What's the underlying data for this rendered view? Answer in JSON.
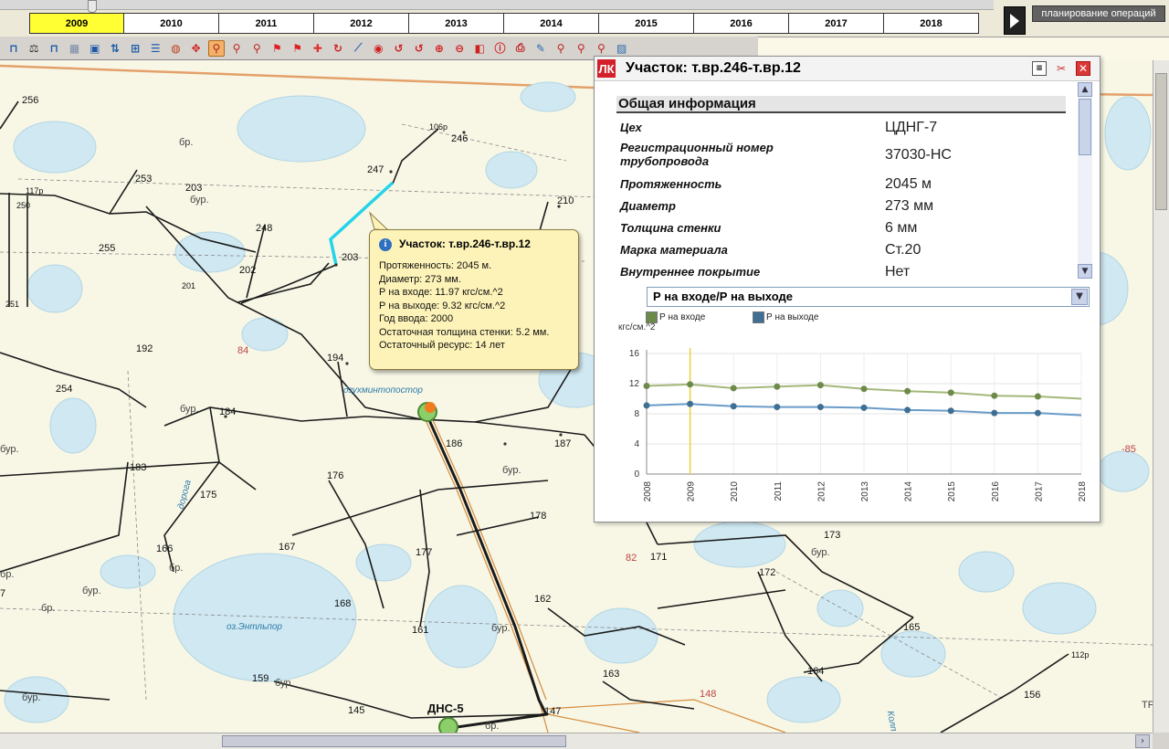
{
  "timeline": {
    "years": [
      "2009",
      "2010",
      "2011",
      "2012",
      "2013",
      "2014",
      "2015",
      "2016",
      "2017",
      "2018"
    ],
    "active_year": "2009",
    "ops_button": "планирование операций"
  },
  "toolbar": {
    "icons": [
      "pipe-shape-icon",
      "weight-icon",
      "pipe-shape-icon",
      "hatch-icon",
      "window-layout-icon",
      "sort-icon",
      "tree-icon",
      "list-icon",
      "globe-icon",
      "target-icon",
      "pin-active-icon",
      "pin-icon",
      "pin-icon",
      "flag-icon",
      "flag-icon",
      "plus-icon",
      "refresh-icon",
      "ruler-icon",
      "zoom-icon",
      "rotate-icon",
      "rotate-icon",
      "zoom-in-icon",
      "zoom-out-icon",
      "layers-icon",
      "info-icon",
      "print-icon",
      "pencil-icon",
      "pin-icon",
      "pin-icon",
      "pin-icon",
      "image-icon"
    ],
    "active_index": 10
  },
  "map": {
    "labels": [
      {
        "text": "256",
        "x": 24,
        "y": 38
      },
      {
        "text": "бр.",
        "x": 196,
        "y": 84,
        "cls": "gray"
      },
      {
        "text": "106р",
        "x": 470,
        "y": 68,
        "cls": "small"
      },
      {
        "text": "246",
        "x": 494,
        "y": 80
      },
      {
        "text": "117р",
        "x": 28,
        "y": 138,
        "cls": "small"
      },
      {
        "text": "253",
        "x": 148,
        "y": 124
      },
      {
        "text": "247",
        "x": 402,
        "y": 114
      },
      {
        "text": "бур.",
        "x": 208,
        "y": 147,
        "cls": "gray"
      },
      {
        "text": "250",
        "x": 18,
        "y": 154,
        "cls": "small"
      },
      {
        "text": "203",
        "x": 203,
        "y": 134
      },
      {
        "text": "210",
        "x": 610,
        "y": 148
      },
      {
        "text": "248",
        "x": 280,
        "y": 178
      },
      {
        "text": "255",
        "x": 108,
        "y": 200
      },
      {
        "text": "202",
        "x": 262,
        "y": 224
      },
      {
        "text": "203",
        "x": 374,
        "y": 210
      },
      {
        "text": "201",
        "x": 199,
        "y": 242,
        "cls": "small"
      },
      {
        "text": "251",
        "x": 6,
        "y": 262,
        "cls": "small"
      },
      {
        "text": "192",
        "x": 149,
        "y": 310
      },
      {
        "text": "84",
        "x": 260,
        "y": 312,
        "cls": "red"
      },
      {
        "text": "194",
        "x": 358,
        "y": 320
      },
      {
        "text": "254",
        "x": 61,
        "y": 354
      },
      {
        "text": "бур.",
        "x": 197,
        "y": 376,
        "cls": "gray"
      },
      {
        "text": "184",
        "x": 240,
        "y": 379
      },
      {
        "text": "бур.",
        "x": 0,
        "y": 420,
        "cls": "gray"
      },
      {
        "text": "186",
        "x": 488,
        "y": 414
      },
      {
        "text": "187",
        "x": 607,
        "y": 414
      },
      {
        "text": "183",
        "x": 142,
        "y": 440
      },
      {
        "text": "бур.",
        "x": 550,
        "y": 443,
        "cls": "gray"
      },
      {
        "text": "176",
        "x": 358,
        "y": 449
      },
      {
        "text": "175",
        "x": 219,
        "y": 470
      },
      {
        "text": "178",
        "x": 580,
        "y": 493
      },
      {
        "text": "166",
        "x": 171,
        "y": 529
      },
      {
        "text": "167",
        "x": 305,
        "y": 527
      },
      {
        "text": "177",
        "x": 455,
        "y": 533
      },
      {
        "text": "82",
        "x": 685,
        "y": 539,
        "cls": "red"
      },
      {
        "text": "171",
        "x": 712,
        "y": 538
      },
      {
        "text": "бур.",
        "x": 888,
        "y": 533,
        "cls": "gray"
      },
      {
        "text": "173",
        "x": 902,
        "y": 514
      },
      {
        "text": "172",
        "x": 831,
        "y": 555
      },
      {
        "text": "бр.",
        "x": 185,
        "y": 550,
        "cls": "gray"
      },
      {
        "text": "бр.",
        "x": 45,
        "y": 594,
        "cls": "gray"
      },
      {
        "text": "бр.",
        "x": 0,
        "y": 557,
        "cls": "gray"
      },
      {
        "text": "бур.",
        "x": 90,
        "y": 575,
        "cls": "gray"
      },
      {
        "text": "168",
        "x": 366,
        "y": 589
      },
      {
        "text": "162",
        "x": 585,
        "y": 584
      },
      {
        "text": "оз.Энтльпор",
        "x": 248,
        "y": 615,
        "cls": "blue"
      },
      {
        "text": "161",
        "x": 451,
        "y": 618
      },
      {
        "text": "бур.",
        "x": 538,
        "y": 616,
        "cls": "gray"
      },
      {
        "text": "165",
        "x": 989,
        "y": 615
      },
      {
        "text": "163",
        "x": 660,
        "y": 666
      },
      {
        "text": "164",
        "x": 884,
        "y": 663
      },
      {
        "text": "112р",
        "x": 1173,
        "y": 646,
        "cls": "small"
      },
      {
        "text": "159",
        "x": 276,
        "y": 671
      },
      {
        "text": "бур.",
        "x": 301,
        "y": 676,
        "cls": "gray"
      },
      {
        "text": "бур.",
        "x": 24,
        "y": 692,
        "cls": "gray"
      },
      {
        "text": "148",
        "x": 766,
        "y": 688,
        "cls": "red"
      },
      {
        "text": "156",
        "x": 1121,
        "y": 689
      },
      {
        "text": "145",
        "x": 381,
        "y": 706
      },
      {
        "text": "147",
        "x": 596,
        "y": 707
      },
      {
        "text": "бр.",
        "x": 531,
        "y": 723,
        "cls": "gray"
      },
      {
        "text": "7",
        "x": 0,
        "y": 578
      },
      {
        "text": "-85",
        "x": 1228,
        "y": 420,
        "cls": "red"
      },
      {
        "text": "ТР",
        "x": 1250,
        "y": 700,
        "cls": "gray"
      },
      {
        "text": "Колп",
        "x": 965,
        "y": 718,
        "cls": "blue"
      },
      {
        "text": "дорога",
        "x": 186,
        "y": 470,
        "cls": "blue"
      },
      {
        "text": "дзухминтопостор",
        "x": 376,
        "y": 356,
        "cls": "blue"
      }
    ],
    "dns_label": "ДНС-5"
  },
  "tooltip": {
    "title": "Участок: т.вр.246-т.вр.12",
    "lines": [
      "Протяженность: 2045 м.",
      "Диаметр: 273 мм.",
      "Р на входе: 11.97 кгс/см.^2",
      "Р на выходе: 9.32 кгс/см.^2",
      "Год ввода: 2000",
      "Остаточная толщина стенки: 5.2 мм.",
      "Остаточный ресурс: 14 лет"
    ]
  },
  "panel": {
    "logo": "ЛК",
    "title": "Участок: т.вр.246-т.вр.12",
    "section_title": "Общая информация",
    "fields": [
      {
        "label": "Цех",
        "value": "ЦДНГ-7"
      },
      {
        "label": "Регистрационный номер трубопровода",
        "value": "37030-НС"
      },
      {
        "label": "Протяженность",
        "value": "2045 м"
      },
      {
        "label": "Диаметр",
        "value": "273 мм"
      },
      {
        "label": "Толщина стенки",
        "value": "6 мм"
      },
      {
        "label": "Марка материала",
        "value": "Ст.20"
      },
      {
        "label": "Внутреннее покрытие",
        "value": "Нет"
      }
    ],
    "select_value": "Р на входе/Р на выходе",
    "units_label": "кгс/см.^2"
  },
  "chart_data": {
    "type": "line",
    "x": [
      "2008",
      "2009",
      "2010",
      "2011",
      "2012",
      "2013",
      "2014",
      "2015",
      "2016",
      "2017",
      "2018"
    ],
    "series": [
      {
        "name": "Р на входе",
        "color": "#a3b87a",
        "marker": "#6e8a4a",
        "values": [
          11.7,
          11.9,
          11.4,
          11.6,
          11.8,
          11.3,
          11.0,
          10.8,
          10.4,
          10.3,
          10.0
        ]
      },
      {
        "name": "Р на выходе",
        "color": "#6a9cc8",
        "marker": "#3f6f93",
        "values": [
          9.1,
          9.3,
          9.0,
          8.9,
          8.9,
          8.8,
          8.5,
          8.4,
          8.1,
          8.1,
          7.8
        ]
      }
    ],
    "ylim": [
      0,
      16
    ],
    "yticks": [
      0,
      4,
      8,
      12,
      16
    ],
    "highlight_x": "2009",
    "legend_position": "top-left",
    "grid": true
  }
}
